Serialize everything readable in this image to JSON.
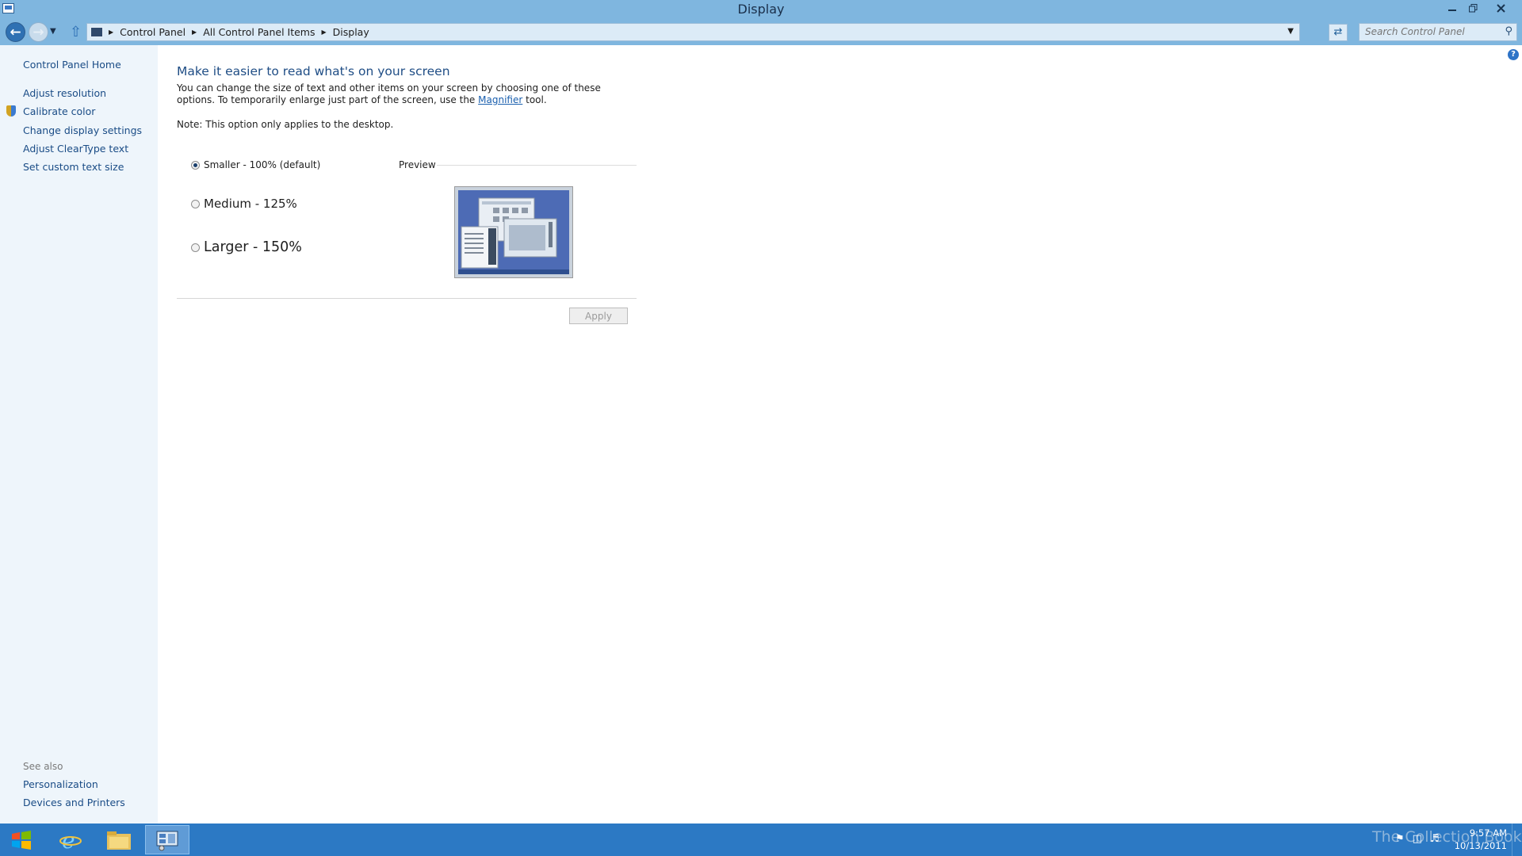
{
  "window": {
    "title": "Display"
  },
  "breadcrumb": [
    "Control Panel",
    "All Control Panel Items",
    "Display"
  ],
  "search": {
    "placeholder": "Search Control Panel"
  },
  "sidebar": {
    "home": "Control Panel Home",
    "links": [
      "Adjust resolution",
      "Calibrate color",
      "Change display settings",
      "Adjust ClearType text",
      "Set custom text size"
    ],
    "see_also_label": "See also",
    "see_also": [
      "Personalization",
      "Devices and Printers"
    ]
  },
  "main": {
    "heading": "Make it easier to read what's on your screen",
    "desc_part1": "You can change the size of text and other items on your screen by choosing one of these options. To temporarily enlarge just part of the screen, use the",
    "desc_link": "Magnifier",
    "desc_part2": "tool.",
    "note": "Note: This option only applies to the desktop.",
    "options": [
      {
        "label": "Smaller - 100% (default)",
        "selected": true
      },
      {
        "label": "Medium - 125%",
        "selected": false
      },
      {
        "label": "Larger - 150%",
        "selected": false
      }
    ],
    "preview_label": "Preview",
    "apply_label": "Apply"
  },
  "taskbar": {
    "apps": [
      "internet-explorer",
      "file-explorer",
      "control-panel"
    ],
    "watermark": "The Collection Book",
    "time": "9:57 AM",
    "date": "10/13/2011"
  },
  "colors": {
    "titlebar": "#7fb6df",
    "sidebar_bg": "#eef5fb",
    "link": "#1a4c86",
    "heading": "#1f4d85",
    "taskbar": "#2c79c4"
  }
}
